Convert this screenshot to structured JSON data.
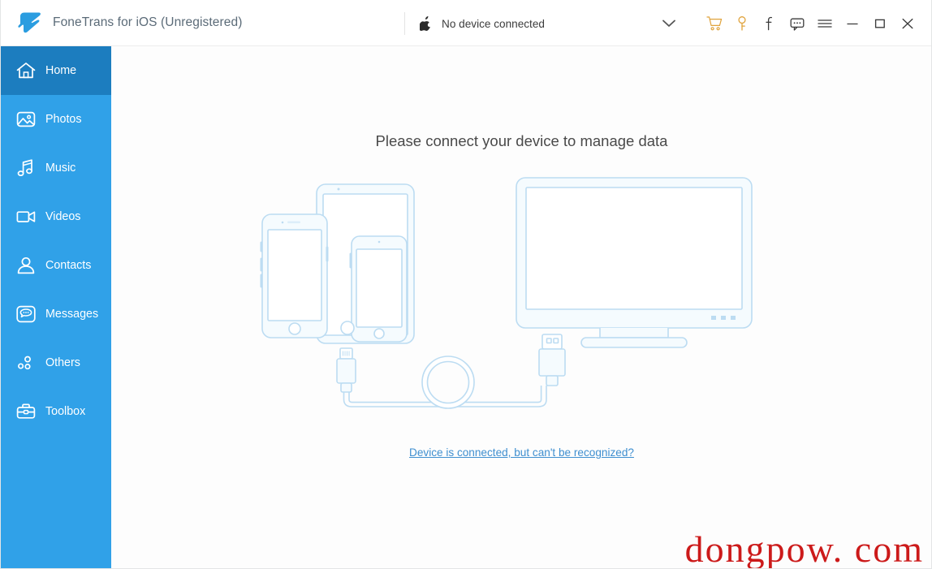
{
  "window": {
    "app_title": "FoneTrans for iOS (Unregistered)",
    "logo_icon": "fonetrans-logo-icon"
  },
  "device_selector": {
    "apple_icon": "apple-icon",
    "label": "No device connected",
    "chevron_icon": "chevron-down-icon"
  },
  "titlebar_actions": [
    {
      "name": "cart-icon",
      "tooltip": "Buy"
    },
    {
      "name": "key-icon",
      "tooltip": "Register"
    },
    {
      "name": "facebook-icon",
      "tooltip": "Facebook"
    },
    {
      "name": "feedback-icon",
      "tooltip": "Feedback"
    },
    {
      "name": "menu-icon",
      "tooltip": "Menu"
    },
    {
      "name": "minimize-icon",
      "tooltip": "Minimize"
    },
    {
      "name": "maximize-icon",
      "tooltip": "Maximize"
    },
    {
      "name": "close-icon",
      "tooltip": "Close"
    }
  ],
  "sidebar": {
    "items": [
      {
        "label": "Home",
        "icon": "home-icon",
        "active": true
      },
      {
        "label": "Photos",
        "icon": "photos-icon",
        "active": false
      },
      {
        "label": "Music",
        "icon": "music-icon",
        "active": false
      },
      {
        "label": "Videos",
        "icon": "videos-icon",
        "active": false
      },
      {
        "label": "Contacts",
        "icon": "contacts-icon",
        "active": false
      },
      {
        "label": "Messages",
        "icon": "messages-icon",
        "active": false
      },
      {
        "label": "Others",
        "icon": "others-icon",
        "active": false
      },
      {
        "label": "Toolbox",
        "icon": "toolbox-icon",
        "active": false
      }
    ]
  },
  "main": {
    "headline": "Please connect your device to manage data",
    "help_link": "Device is connected, but can't be recognized?",
    "illustration_name": "connect-device-illustration"
  },
  "watermark": {
    "text": "dongpow. com"
  },
  "colors": {
    "sidebar_blue": "#30a1e8",
    "sidebar_active_blue": "#1c7dbf",
    "brand_text": "#5b6b78",
    "link_blue": "#3f8fd0",
    "illustration_stroke": "#bcdcf2",
    "illustration_fill": "#f3fafe",
    "watermark_red": "#cc1a1a",
    "accent_orange": "#e0a33c"
  }
}
